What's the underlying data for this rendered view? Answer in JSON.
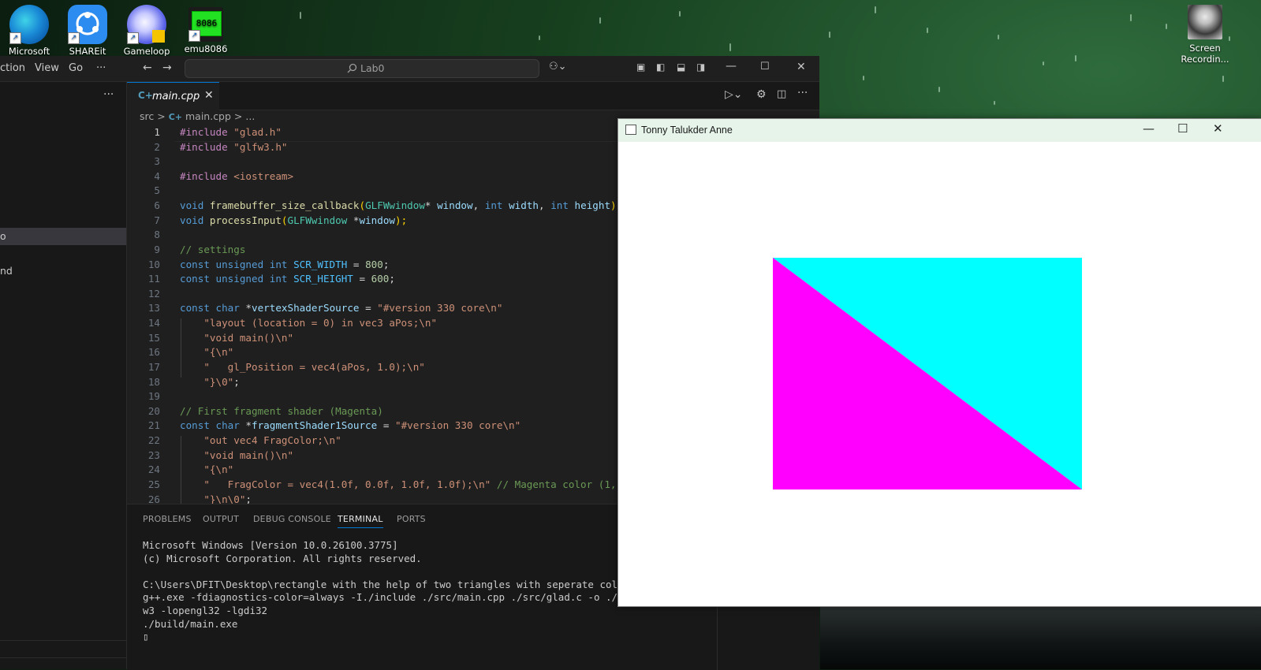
{
  "desktop": {
    "icons": [
      {
        "label": "Microsoft",
        "icon": "edge-icon"
      },
      {
        "label": "SHAREit",
        "icon": "shareit-icon"
      },
      {
        "label": "Gameloop",
        "icon": "gameloop-icon"
      },
      {
        "label": "emu8086",
        "icon": "chip-icon",
        "chip_text": "8086"
      }
    ],
    "right_icon": {
      "label_line1": "Screen",
      "label_line2": "Recordin...",
      "icon": "avatar-icon"
    }
  },
  "vscode": {
    "menu": [
      "ction",
      "View",
      "Go",
      "···"
    ],
    "search_text": "Lab0",
    "sidebar": {
      "more": "···",
      "selected_fragment": "o",
      "fragment2": "nd"
    },
    "tab": {
      "file_icon": "C+",
      "label": "main.cpp",
      "close": "✕"
    },
    "breadcrumb": {
      "folder": "src",
      "sep1": ">",
      "file_icon": "C+",
      "file": "main.cpp",
      "sep2": ">",
      "rest": "..."
    },
    "code": [
      [
        {
          "t": "#include ",
          "c": "#c586c0"
        },
        {
          "t": "\"glad.h\"",
          "c": "#ce9178"
        }
      ],
      [
        {
          "t": "#include ",
          "c": "#c586c0"
        },
        {
          "t": "\"glfw3.h\"",
          "c": "#ce9178"
        }
      ],
      [],
      [
        {
          "t": "#include ",
          "c": "#c586c0"
        },
        {
          "t": "<iostream>",
          "c": "#ce9178"
        }
      ],
      [],
      [
        {
          "t": "void ",
          "c": "#569cd6"
        },
        {
          "t": "framebuffer_size_callback",
          "c": "#dcdcaa"
        },
        {
          "t": "(",
          "c": "#ffd700"
        },
        {
          "t": "GLFWwindow",
          "c": "#4ec9b0"
        },
        {
          "t": "* ",
          "c": "#d4d4d4"
        },
        {
          "t": "window",
          "c": "#9cdcfe"
        },
        {
          "t": ", ",
          "c": "#d4d4d4"
        },
        {
          "t": "int ",
          "c": "#569cd6"
        },
        {
          "t": "width",
          "c": "#9cdcfe"
        },
        {
          "t": ", ",
          "c": "#d4d4d4"
        },
        {
          "t": "int ",
          "c": "#569cd6"
        },
        {
          "t": "height",
          "c": "#9cdcfe"
        },
        {
          "t": ");",
          "c": "#ffd700"
        }
      ],
      [
        {
          "t": "void ",
          "c": "#569cd6"
        },
        {
          "t": "processInput",
          "c": "#dcdcaa"
        },
        {
          "t": "(",
          "c": "#ffd700"
        },
        {
          "t": "GLFWwindow ",
          "c": "#4ec9b0"
        },
        {
          "t": "*",
          "c": "#d4d4d4"
        },
        {
          "t": "window",
          "c": "#9cdcfe"
        },
        {
          "t": ");",
          "c": "#ffd700"
        }
      ],
      [],
      [
        {
          "t": "// settings",
          "c": "#6a9955"
        }
      ],
      [
        {
          "t": "const unsigned int ",
          "c": "#569cd6"
        },
        {
          "t": "SCR_WIDTH",
          "c": "#4fc1ff"
        },
        {
          "t": " = ",
          "c": "#d4d4d4"
        },
        {
          "t": "800",
          "c": "#b5cea8"
        },
        {
          "t": ";",
          "c": "#d4d4d4"
        }
      ],
      [
        {
          "t": "const unsigned int ",
          "c": "#569cd6"
        },
        {
          "t": "SCR_HEIGHT",
          "c": "#4fc1ff"
        },
        {
          "t": " = ",
          "c": "#d4d4d4"
        },
        {
          "t": "600",
          "c": "#b5cea8"
        },
        {
          "t": ";",
          "c": "#d4d4d4"
        }
      ],
      [],
      [
        {
          "t": "const char ",
          "c": "#569cd6"
        },
        {
          "t": "*",
          "c": "#d4d4d4"
        },
        {
          "t": "vertexShaderSource",
          "c": "#9cdcfe"
        },
        {
          "t": " = ",
          "c": "#d4d4d4"
        },
        {
          "t": "\"#version 330 core\\n\"",
          "c": "#ce9178"
        }
      ],
      [
        {
          "t": "    \"layout (location = 0) in vec3 aPos;\\n\"",
          "c": "#ce9178"
        }
      ],
      [
        {
          "t": "    \"void main()\\n\"",
          "c": "#ce9178"
        }
      ],
      [
        {
          "t": "    \"{\\n\"",
          "c": "#ce9178"
        }
      ],
      [
        {
          "t": "    \"   gl_Position = vec4(aPos, 1.0);\\n\"",
          "c": "#ce9178"
        }
      ],
      [
        {
          "t": "    \"}\\0\"",
          "c": "#ce9178"
        },
        {
          "t": ";",
          "c": "#d4d4d4"
        }
      ],
      [],
      [
        {
          "t": "// First fragment shader (Magenta)",
          "c": "#6a9955"
        }
      ],
      [
        {
          "t": "const char ",
          "c": "#569cd6"
        },
        {
          "t": "*",
          "c": "#d4d4d4"
        },
        {
          "t": "fragmentShader1Source",
          "c": "#9cdcfe"
        },
        {
          "t": " = ",
          "c": "#d4d4d4"
        },
        {
          "t": "\"#version 330 core\\n\"",
          "c": "#ce9178"
        }
      ],
      [
        {
          "t": "    \"out vec4 FragColor;\\n\"",
          "c": "#ce9178"
        }
      ],
      [
        {
          "t": "    \"void main()\\n\"",
          "c": "#ce9178"
        }
      ],
      [
        {
          "t": "    \"{\\n\"",
          "c": "#ce9178"
        }
      ],
      [
        {
          "t": "    \"   FragColor = vec4(1.0f, 0.0f, 1.0f, 1.0f);\\n\"",
          "c": "#ce9178"
        },
        {
          "t": " // Magenta color (1,",
          "c": "#6a9955"
        }
      ],
      [
        {
          "t": "    \"}\\n\\0\"",
          "c": "#ce9178"
        },
        {
          "t": ";",
          "c": "#d4d4d4"
        }
      ]
    ],
    "panel_tabs": [
      "PROBLEMS",
      "OUTPUT",
      "DEBUG CONSOLE",
      "TERMINAL",
      "PORTS"
    ],
    "active_panel_tab": 3,
    "terminal": [
      "Microsoft Windows [Version 10.0.26100.3775]",
      "(c) Microsoft Corporation. All rights reserved.",
      "",
      "C:\\Users\\DFIT\\Desktop\\rectangle with the help of two triangles with seperate colors each",
      "g++.exe -fdiagnostics-color=always -I./include ./src/main.cpp ./src/glad.c -o ./build/ma",
      "w3 -lopengl32 -lgdi32",
      "./build/main.exe",
      "▯"
    ]
  },
  "gl_window": {
    "title": "Tonny Talukder Anne",
    "minimize": "—",
    "maximize": "☐",
    "close": "✕",
    "colors": {
      "magenta": "#ff00ff",
      "cyan": "#00ffff"
    }
  }
}
